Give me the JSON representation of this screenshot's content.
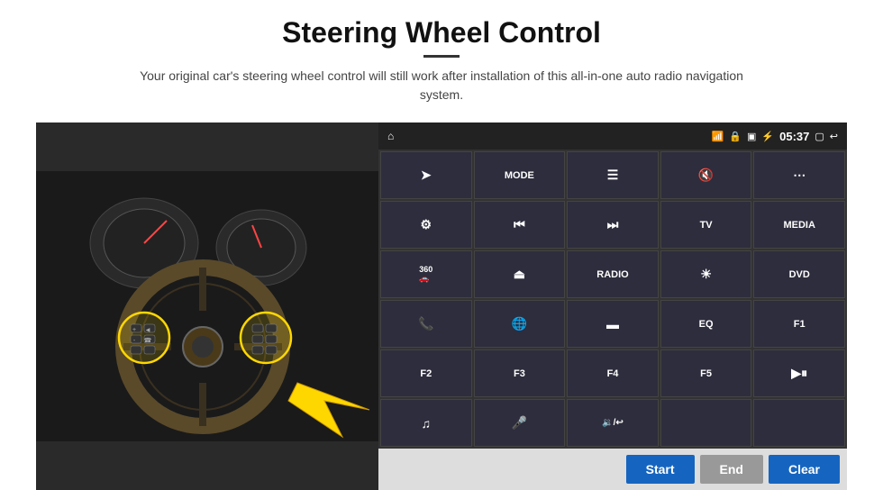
{
  "header": {
    "title": "Steering Wheel Control",
    "subtitle": "Your original car's steering wheel control will still work after installation of this all-in-one auto radio navigation system.",
    "divider": true
  },
  "status_bar": {
    "left_icon": "home-icon",
    "wifi_icon": "wifi-icon",
    "lock_icon": "lock-icon",
    "sim_icon": "sim-icon",
    "bt_icon": "bluetooth-icon",
    "time": "05:37",
    "screen_icon": "screen-icon",
    "back_icon": "back-icon"
  },
  "buttons": [
    {
      "id": "r1c1",
      "type": "icon",
      "icon": "navigate-icon",
      "label": "▶"
    },
    {
      "id": "r1c2",
      "type": "text",
      "label": "MODE"
    },
    {
      "id": "r1c3",
      "type": "icon",
      "icon": "list-icon",
      "label": "☰"
    },
    {
      "id": "r1c4",
      "type": "icon",
      "icon": "mute-icon",
      "label": "🔇"
    },
    {
      "id": "r1c5",
      "type": "icon",
      "icon": "apps-icon",
      "label": "⋯"
    },
    {
      "id": "r2c1",
      "type": "icon",
      "icon": "settings-icon",
      "label": "⚙"
    },
    {
      "id": "r2c2",
      "type": "icon",
      "icon": "prev-icon",
      "label": "⏮"
    },
    {
      "id": "r2c3",
      "type": "icon",
      "icon": "next-icon",
      "label": "⏭"
    },
    {
      "id": "r2c4",
      "type": "text",
      "label": "TV"
    },
    {
      "id": "r2c5",
      "type": "text",
      "label": "MEDIA"
    },
    {
      "id": "r3c1",
      "type": "icon",
      "icon": "cam360-icon",
      "label": "360"
    },
    {
      "id": "r3c2",
      "type": "icon",
      "icon": "eject-icon",
      "label": "⏏"
    },
    {
      "id": "r3c3",
      "type": "text",
      "label": "RADIO"
    },
    {
      "id": "r3c4",
      "type": "icon",
      "icon": "brightness-icon",
      "label": "☀"
    },
    {
      "id": "r3c5",
      "type": "text",
      "label": "DVD"
    },
    {
      "id": "r4c1",
      "type": "icon",
      "icon": "phone-icon",
      "label": "📞"
    },
    {
      "id": "r4c2",
      "type": "icon",
      "icon": "globe-icon",
      "label": "🌐"
    },
    {
      "id": "r4c3",
      "type": "icon",
      "icon": "panel-icon",
      "label": "▬"
    },
    {
      "id": "r4c4",
      "type": "text",
      "label": "EQ"
    },
    {
      "id": "r4c5",
      "type": "text",
      "label": "F1"
    },
    {
      "id": "r5c1",
      "type": "text",
      "label": "F2"
    },
    {
      "id": "r5c2",
      "type": "text",
      "label": "F3"
    },
    {
      "id": "r5c3",
      "type": "text",
      "label": "F4"
    },
    {
      "id": "r5c4",
      "type": "text",
      "label": "F5"
    },
    {
      "id": "r5c5",
      "type": "icon",
      "icon": "playpause-icon",
      "label": "▶⏸"
    },
    {
      "id": "r6c1",
      "type": "icon",
      "icon": "music-icon",
      "label": "♫"
    },
    {
      "id": "r6c2",
      "type": "icon",
      "icon": "mic-icon",
      "label": "🎤"
    },
    {
      "id": "r6c3",
      "type": "icon",
      "icon": "vol-icon",
      "label": "🔉/↩"
    },
    {
      "id": "r6c4",
      "type": "empty",
      "label": ""
    },
    {
      "id": "r6c5",
      "type": "empty",
      "label": ""
    }
  ],
  "action_bar": {
    "start_label": "Start",
    "end_label": "End",
    "clear_label": "Clear"
  }
}
